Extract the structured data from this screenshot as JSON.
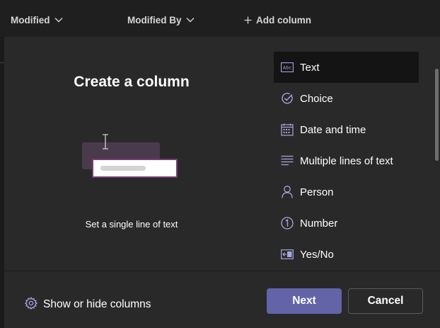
{
  "header": {
    "columns": [
      {
        "label": "Modified"
      },
      {
        "label": "Modified By"
      }
    ],
    "add_column_label": "Add column"
  },
  "panel": {
    "title": "Create a column",
    "description": "Set a single line of text",
    "selected_type": "Text",
    "types": [
      {
        "label": "Text",
        "icon": "text-abc-icon"
      },
      {
        "label": "Choice",
        "icon": "check-circle-icon"
      },
      {
        "label": "Date and time",
        "icon": "calendar-icon"
      },
      {
        "label": "Multiple lines of text",
        "icon": "multiline-text-icon"
      },
      {
        "label": "Person",
        "icon": "person-icon"
      },
      {
        "label": "Number",
        "icon": "number-one-icon"
      },
      {
        "label": "Yes/No",
        "icon": "toggle-yes-no-icon"
      }
    ]
  },
  "footer": {
    "show_hide_label": "Show or hide columns",
    "next_label": "Next",
    "cancel_label": "Cancel"
  },
  "colors": {
    "accent": "#6264a7",
    "icon_accent": "#a6a7dc",
    "panel_bg": "#292929",
    "page_bg": "#1f1f1f"
  }
}
